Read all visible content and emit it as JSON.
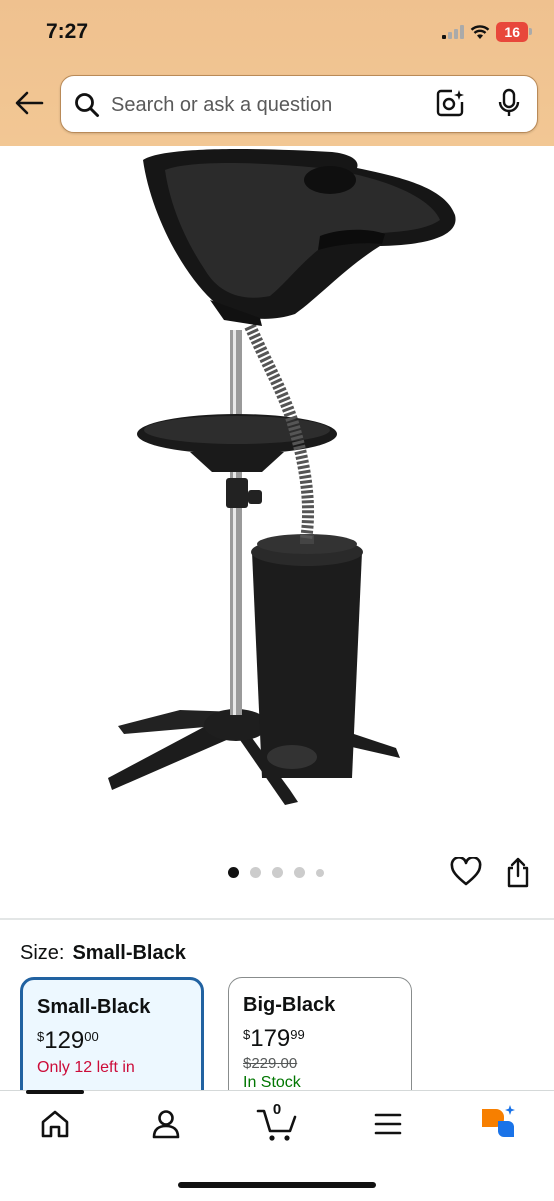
{
  "status_bar": {
    "time": "7:27",
    "battery": "16"
  },
  "search": {
    "placeholder": "Search or ask a question"
  },
  "gallery": {
    "image_count": 5,
    "active_index": 0
  },
  "size": {
    "label": "Size:",
    "selected": "Small-Black",
    "options": [
      {
        "name": "Small-Black",
        "price_currency": "$",
        "price_whole": "129",
        "price_fraction": "00",
        "availability": "Only 12 left in"
      },
      {
        "name": "Big-Black",
        "price_currency": "$",
        "price_whole": "179",
        "price_fraction": "99",
        "list_price": "$229.00",
        "availability": "In Stock"
      }
    ]
  },
  "bottom_nav": {
    "cart_count": "0"
  },
  "colors": {
    "header": "#f2c794",
    "selected_border": "#2162a1",
    "alexa_orange": "#f77f00",
    "alexa_blue": "#1a73e8"
  }
}
